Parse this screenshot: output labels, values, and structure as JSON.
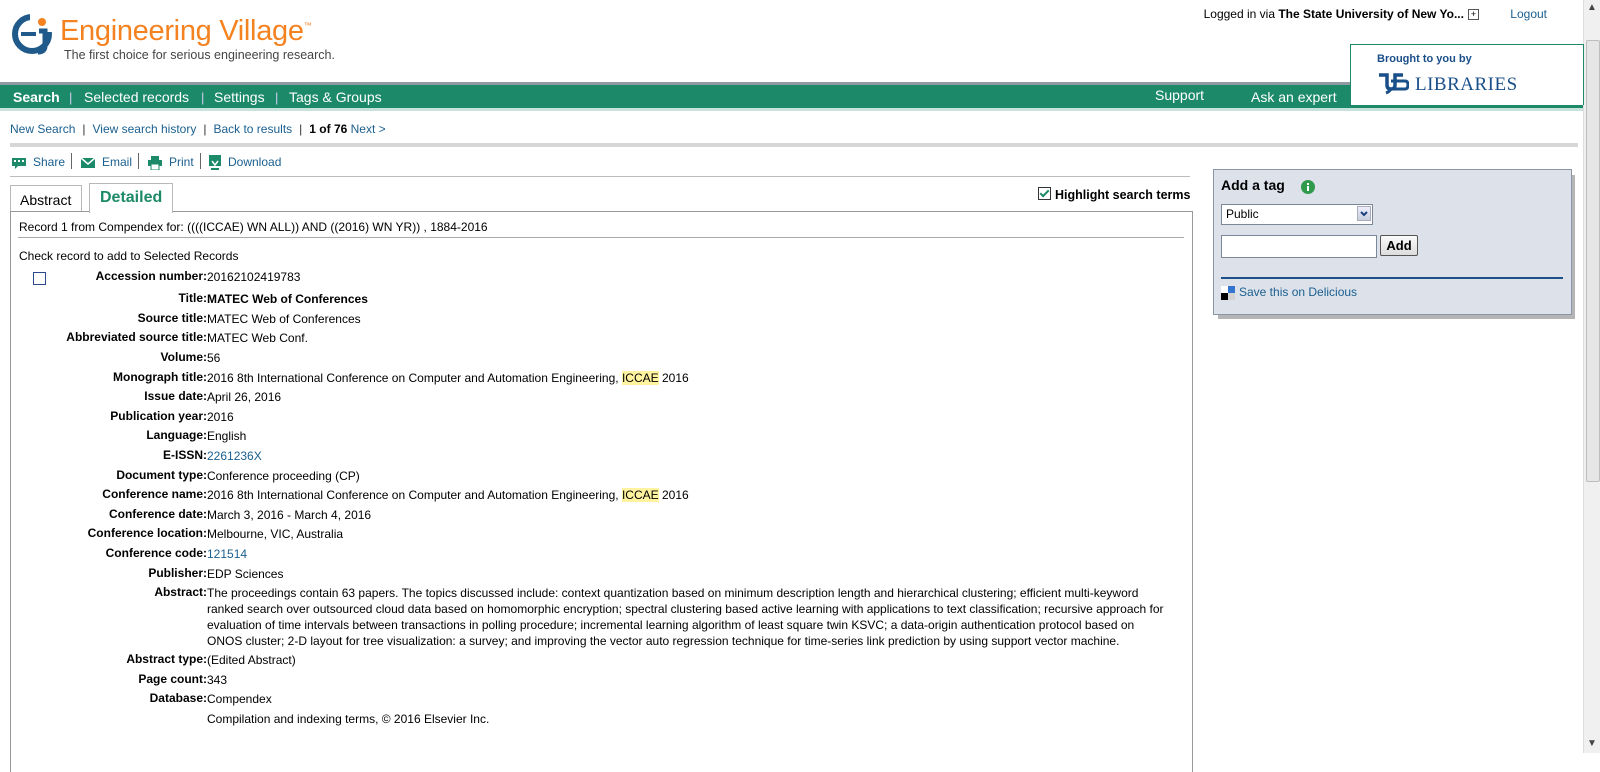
{
  "header": {
    "logo_title": "Engineering Village",
    "logo_tm": "™",
    "tagline": "The first choice for serious engineering research.",
    "login_prefix": "Logged in via",
    "login_institution": "The State University of New Yo...",
    "logout_label": "Logout",
    "brought_label": "Brought to you by",
    "libraries_label": "LIBRARIES"
  },
  "nav": {
    "items": [
      "Search",
      "Selected records",
      "Settings",
      "Tags & Groups"
    ],
    "right_items": [
      "Support",
      "Ask an expert"
    ]
  },
  "subnav": {
    "new_search": "New Search",
    "view_history": "View search history",
    "back_results": "Back to results",
    "position": "1 of 76",
    "next": "Next >"
  },
  "actions": {
    "share": "Share",
    "email": "Email",
    "print": "Print",
    "download": "Download"
  },
  "tabs": {
    "abstract": "Abstract",
    "detailed": "Detailed",
    "highlight_label": "Highlight search terms"
  },
  "record": {
    "header_line": "Record 1 from Compendex for: ((((ICCAE) WN ALL)) AND ((2016) WN YR)) , 1884-2016",
    "check_line": "Check record to add to Selected Records",
    "fields": {
      "accession_label": "Accession number:",
      "accession": "20162102419783",
      "title_label": "Title:",
      "title": "MATEC Web of Conferences",
      "source_label": "Source title:",
      "source": "MATEC Web of Conferences",
      "abbr_label": "Abbreviated source title:",
      "abbr": "MATEC Web Conf.",
      "volume_label": "Volume:",
      "volume": "56",
      "monograph_label": "Monograph title:",
      "monograph_pre": "2016 8th International Conference on Computer and Automation Engineering,",
      "monograph_hl": "ICCAE",
      "monograph_post": "2016",
      "issue_label": "Issue date:",
      "issue": "April 26, 2016",
      "pubyear_label": "Publication year:",
      "pubyear": "2016",
      "language_label": "Language:",
      "language": "English",
      "eissn_label": "E-ISSN:",
      "eissn": "2261236X",
      "doctype_label": "Document type:",
      "doctype": "Conference proceeding (CP)",
      "confname_label": "Conference name:",
      "confname_pre": "2016 8th International Conference on Computer and Automation Engineering,",
      "confname_hl": "ICCAE",
      "confname_post": "2016",
      "confdate_label": "Conference date:",
      "confdate": "March 3, 2016 - March 4, 2016",
      "confloc_label": "Conference location:",
      "confloc": "Melbourne, VIC, Australia",
      "confcode_label": "Conference code:",
      "confcode": "121514",
      "publisher_label": "Publisher:",
      "publisher": "EDP Sciences",
      "abstract_label": "Abstract:",
      "abstract": "The proceedings contain 63 papers. The topics discussed include: context quantization based on minimum description length and hierarchical clustering; efficient multi-keyword ranked search over outsourced cloud data based on homomorphic encryption; spectral clustering based active learning with applications to text classification; recursive approach for evaluation of time intervals between transactions in polling procedure; incremental learning algorithm of least square twin KSVC; a data-origin authentication protocol based on ONOS cluster; 2-D layout for tree visualization: a survey; and improving the vector auto regression technique for time-series link prediction by using support vector machine.",
      "abstype_label": "Abstract type:",
      "abstype": "(Edited Abstract)",
      "pagecount_label": "Page count:",
      "pagecount": "343",
      "database_label": "Database:",
      "database": "Compendex",
      "copyright": "Compilation and indexing terms, © 2016 Elsevier Inc."
    }
  },
  "sidebar": {
    "tag_title": "Add a tag",
    "tag_scope": "Public",
    "tag_input_value": "",
    "add_label": "Add",
    "delicious_label": "Save this on Delicious"
  },
  "colors": {
    "brand_green": "#1c8a68",
    "logo_orange": "#f58220",
    "link_blue": "#1a5f8f",
    "highlight_yellow": "#fff3a0"
  },
  "icons": [
    "share-icon",
    "email-icon",
    "print-icon",
    "download-icon",
    "info-icon",
    "delicious-icon",
    "plus-icon"
  ]
}
